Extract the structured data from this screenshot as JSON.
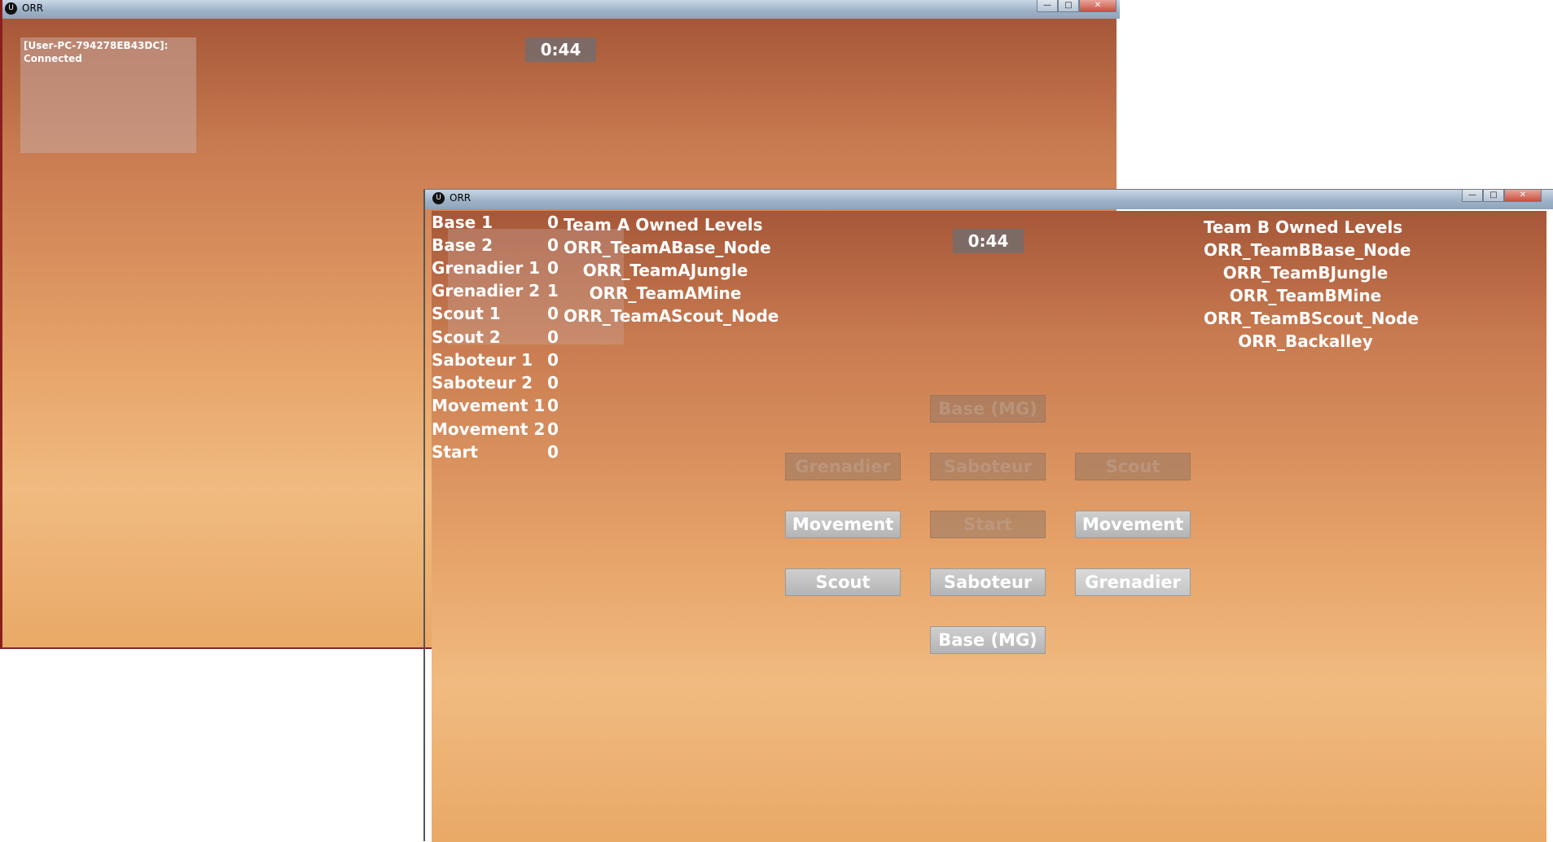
{
  "colors": {
    "sky_top": "#a65738",
    "sky_bottom": "#f0bb80",
    "timer_bg": "#6e6e73",
    "button_bg": "#bdbdbd"
  },
  "window_back": {
    "title": "ORR",
    "logo": "U",
    "controls": {
      "minimize": "—",
      "maximize": "□",
      "close": "✕"
    },
    "timer": "0:44",
    "status": "[User-PC-794278EB43DC]: Connected"
  },
  "window_front": {
    "title": "ORR",
    "logo": "U",
    "controls": {
      "minimize": "—",
      "maximize": "□",
      "close": "✕"
    },
    "timer": "0:44",
    "stats": [
      {
        "name": "Base 1",
        "value": "0"
      },
      {
        "name": "Base 2",
        "value": "0"
      },
      {
        "name": "Grenadier 1",
        "value": "0"
      },
      {
        "name": "Grenadier 2",
        "value": "1"
      },
      {
        "name": "Scout 1",
        "value": "0"
      },
      {
        "name": "Scout 2",
        "value": "0"
      },
      {
        "name": "Saboteur 1",
        "value": "0"
      },
      {
        "name": "Saboteur 2",
        "value": "0"
      },
      {
        "name": "Movement 1",
        "value": "0"
      },
      {
        "name": "Movement 2",
        "value": "0"
      },
      {
        "name": "Start",
        "value": "0"
      }
    ],
    "team_a": {
      "heading": "Team A Owned Levels",
      "levels": [
        "ORR_TeamABase_Node",
        "ORR_TeamAJungle",
        "ORR_TeamAMine",
        "ORR_TeamAScout_Node"
      ]
    },
    "team_b": {
      "heading": "Team B Owned Levels",
      "levels": [
        "ORR_TeamBBase_Node",
        "ORR_TeamBJungle",
        "ORR_TeamBMine",
        "ORR_TeamBScout_Node",
        "ORR_Backalley"
      ]
    },
    "buttons": {
      "base_top": {
        "label": "Base (MG)",
        "enabled": false
      },
      "grenadier_left": {
        "label": "Grenadier",
        "enabled": false
      },
      "saboteur_mid": {
        "label": "Saboteur",
        "enabled": false
      },
      "scout_right": {
        "label": "Scout",
        "enabled": false
      },
      "movement_left": {
        "label": "Movement",
        "enabled": true
      },
      "start": {
        "label": "Start",
        "enabled": false
      },
      "movement_right": {
        "label": "Movement",
        "enabled": true
      },
      "scout_left": {
        "label": "Scout",
        "enabled": true
      },
      "saboteur_bottom": {
        "label": "Saboteur",
        "enabled": true
      },
      "grenadier_right": {
        "label": "Grenadier",
        "enabled": true
      },
      "base_bottom": {
        "label": "Base (MG)",
        "enabled": true
      }
    }
  }
}
